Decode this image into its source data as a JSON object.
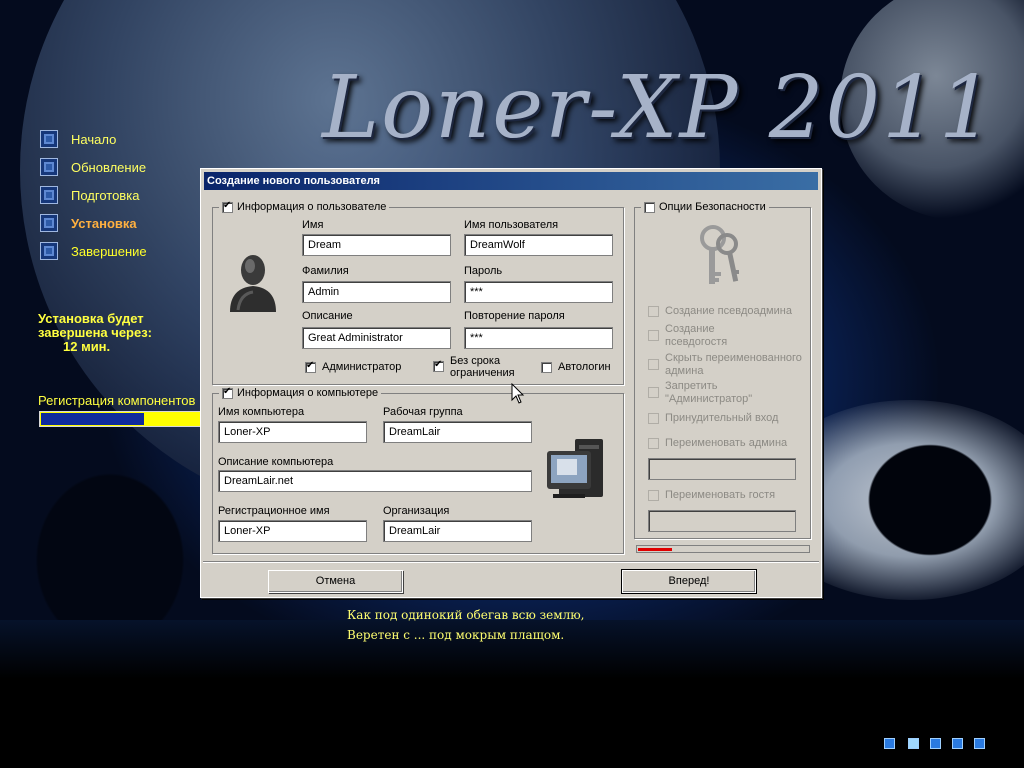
{
  "logo": "Loner-XP 2011",
  "steps": [
    {
      "label": "Начало",
      "state": "done"
    },
    {
      "label": "Обновление",
      "state": "done"
    },
    {
      "label": "Подготовка",
      "state": "done"
    },
    {
      "label": "Установка",
      "state": "active"
    },
    {
      "label": "Завершение",
      "state": "pending"
    }
  ],
  "eta": {
    "line1": "Установка будет",
    "line2": "завершена через:",
    "minutes": "12 мин."
  },
  "registration": {
    "label": "Регистрация компонентов",
    "progress": 0.63
  },
  "poem": [
    "...",
    "Как под одинокий обегав всю землю,",
    "Веретен с ... под мокрым плащом."
  ],
  "dialog": {
    "title": "Создание нового пользователя",
    "user_group": {
      "label": "Информация о пользователе",
      "checked": true,
      "first_name_label": "Имя",
      "first_name": "Dream",
      "username_label": "Имя пользователя",
      "username": "DreamWolf",
      "last_name_label": "Фамилия",
      "last_name": "Admin",
      "password_label": "Пароль",
      "password": "***",
      "description_label": "Описание",
      "description": "Great Administrator",
      "confirm_label": "Повторение пароля",
      "confirm": "***",
      "admin_label": "Администратор",
      "admin_checked": true,
      "noexpire_label": [
        "Без срока",
        "ограничения"
      ],
      "noexpire_checked": true,
      "autologin_label": "Автологин",
      "autologin_checked": false
    },
    "computer_group": {
      "label": "Информация о компьютере",
      "checked": true,
      "name_label": "Имя компьютера",
      "name": "Loner-XP",
      "workgroup_label": "Рабочая группа",
      "workgroup": "DreamLair",
      "description_label": "Описание компьютера",
      "description": "DreamLair.net",
      "regname_label": "Регистрационное имя",
      "regname": "Loner-XP",
      "org_label": "Организация",
      "org": "DreamLair"
    },
    "security_group": {
      "label": "Опции Безопасности",
      "checked": false,
      "items": [
        [
          "Создание псевдоадмина"
        ],
        [
          "Создание",
          "псевдогостя"
        ],
        [
          "Скрыть переименованного",
          "админа"
        ],
        [
          "Запретить",
          "\"Администратор\""
        ],
        [
          "Принудительный вход"
        ],
        [
          "Переименовать админа"
        ],
        [
          "Переименовать гостя"
        ]
      ],
      "rename_admin_value": "",
      "rename_guest_value": "",
      "progress": 0.2
    },
    "cancel_label": "Отмена",
    "next_label": "Вперед!"
  },
  "colors": {
    "step_text": "#ffff2a",
    "step_active": "#ffb040",
    "title_bar": "#0a246a",
    "progress_fill": "#102c9c"
  }
}
